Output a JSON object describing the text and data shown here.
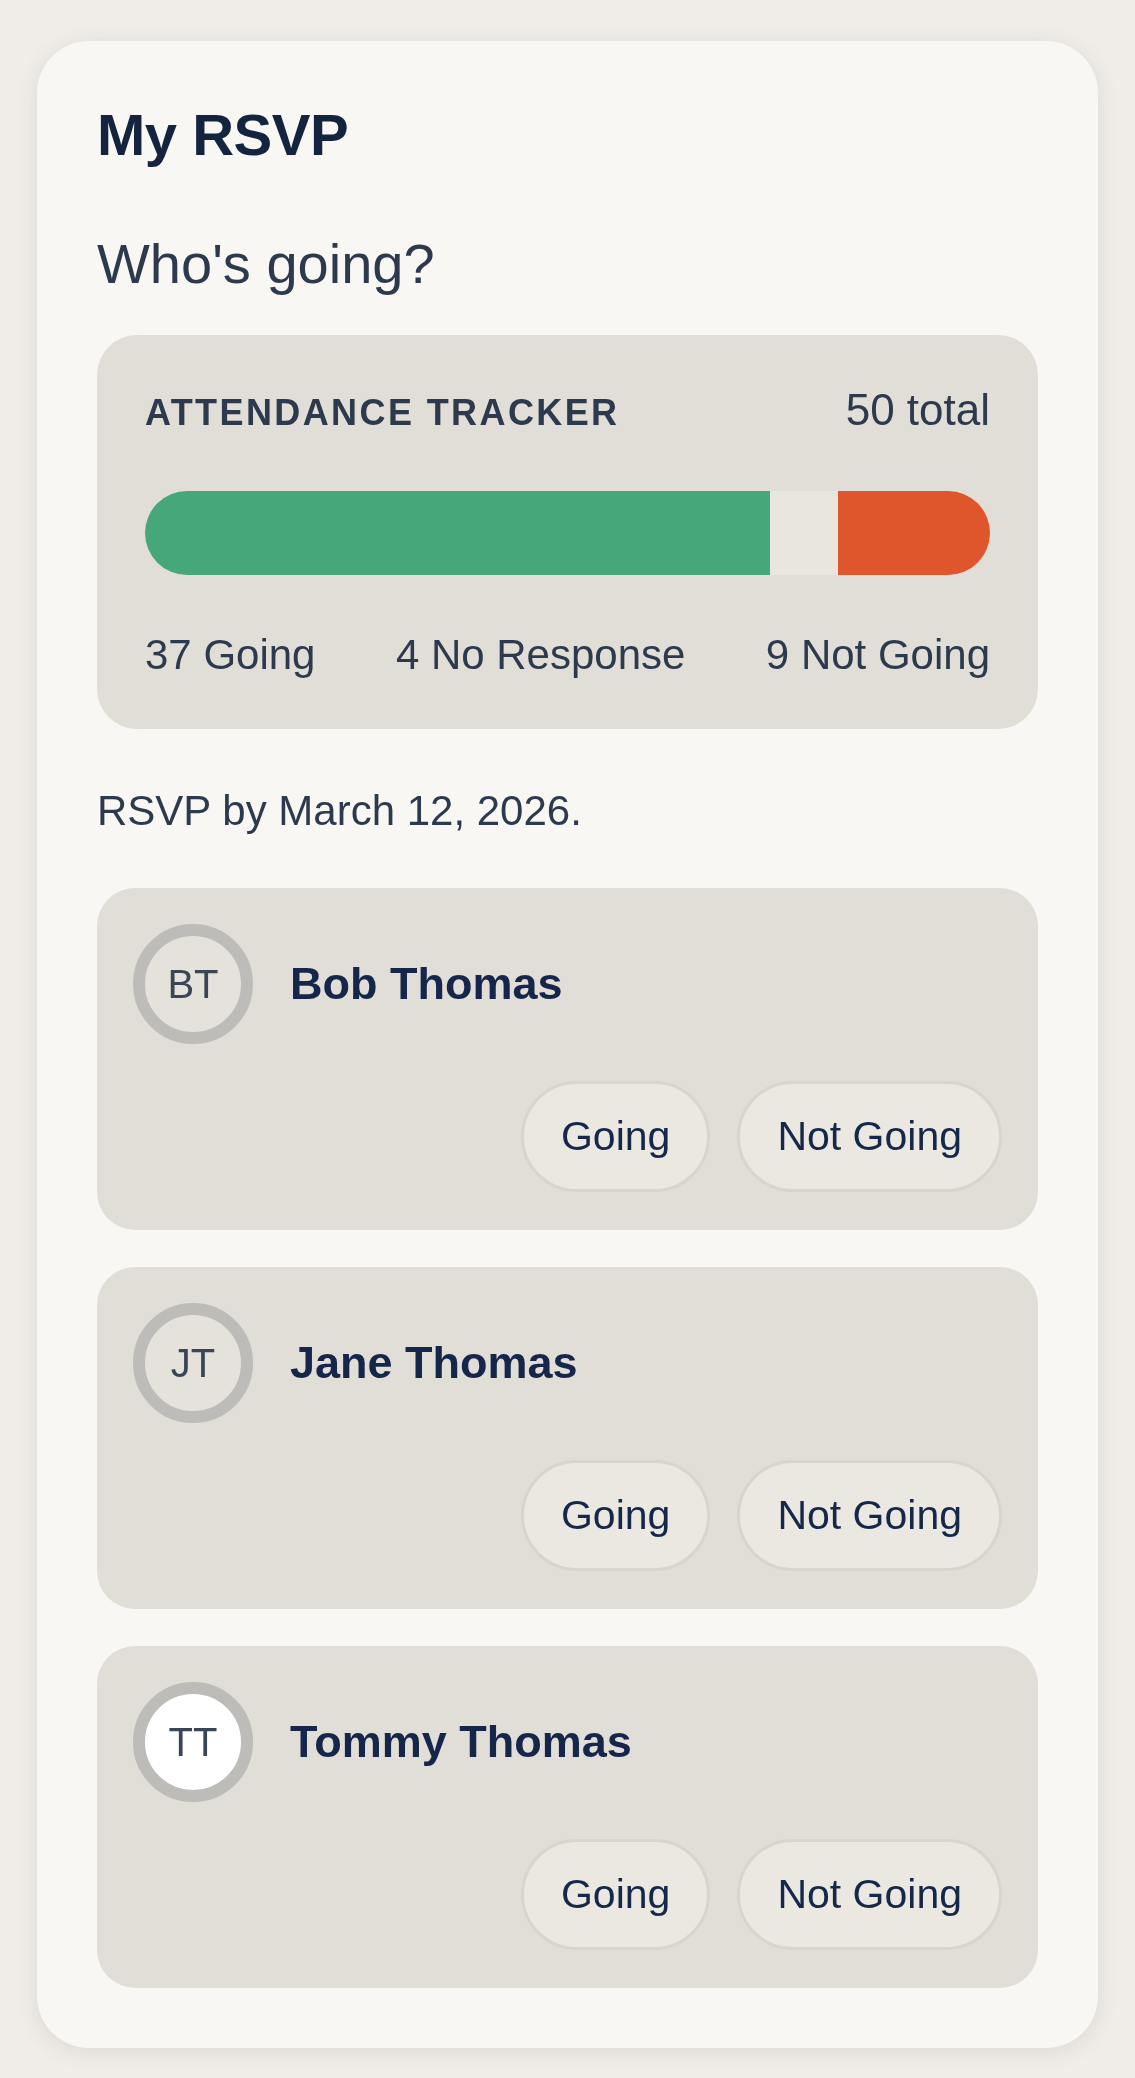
{
  "title": "My RSVP",
  "subtitle": "Who's going?",
  "tracker": {
    "label": "ATTENDANCE TRACKER",
    "total": "50 total",
    "fills": [
      {
        "level": 0.74,
        "color": "#46a87a"
      },
      {
        "level": 0.18,
        "color": "#df552c"
      }
    ],
    "counts": [
      "37 Going",
      "4 No Response",
      "9 Not Going"
    ]
  },
  "deadline": "RSVP by March 12, 2026.",
  "people": [
    {
      "initials": "BT",
      "name": "Bob Thomas",
      "highlighted": false,
      "buttons": [
        "Going",
        "Not Going"
      ]
    },
    {
      "initials": "JT",
      "name": "Jane Thomas",
      "highlighted": false,
      "buttons": [
        "Going",
        "Not Going"
      ]
    },
    {
      "initials": "TT",
      "name": "Tommy Thomas",
      "highlighted": true,
      "buttons": [
        "Going",
        "Not Going"
      ]
    }
  ]
}
